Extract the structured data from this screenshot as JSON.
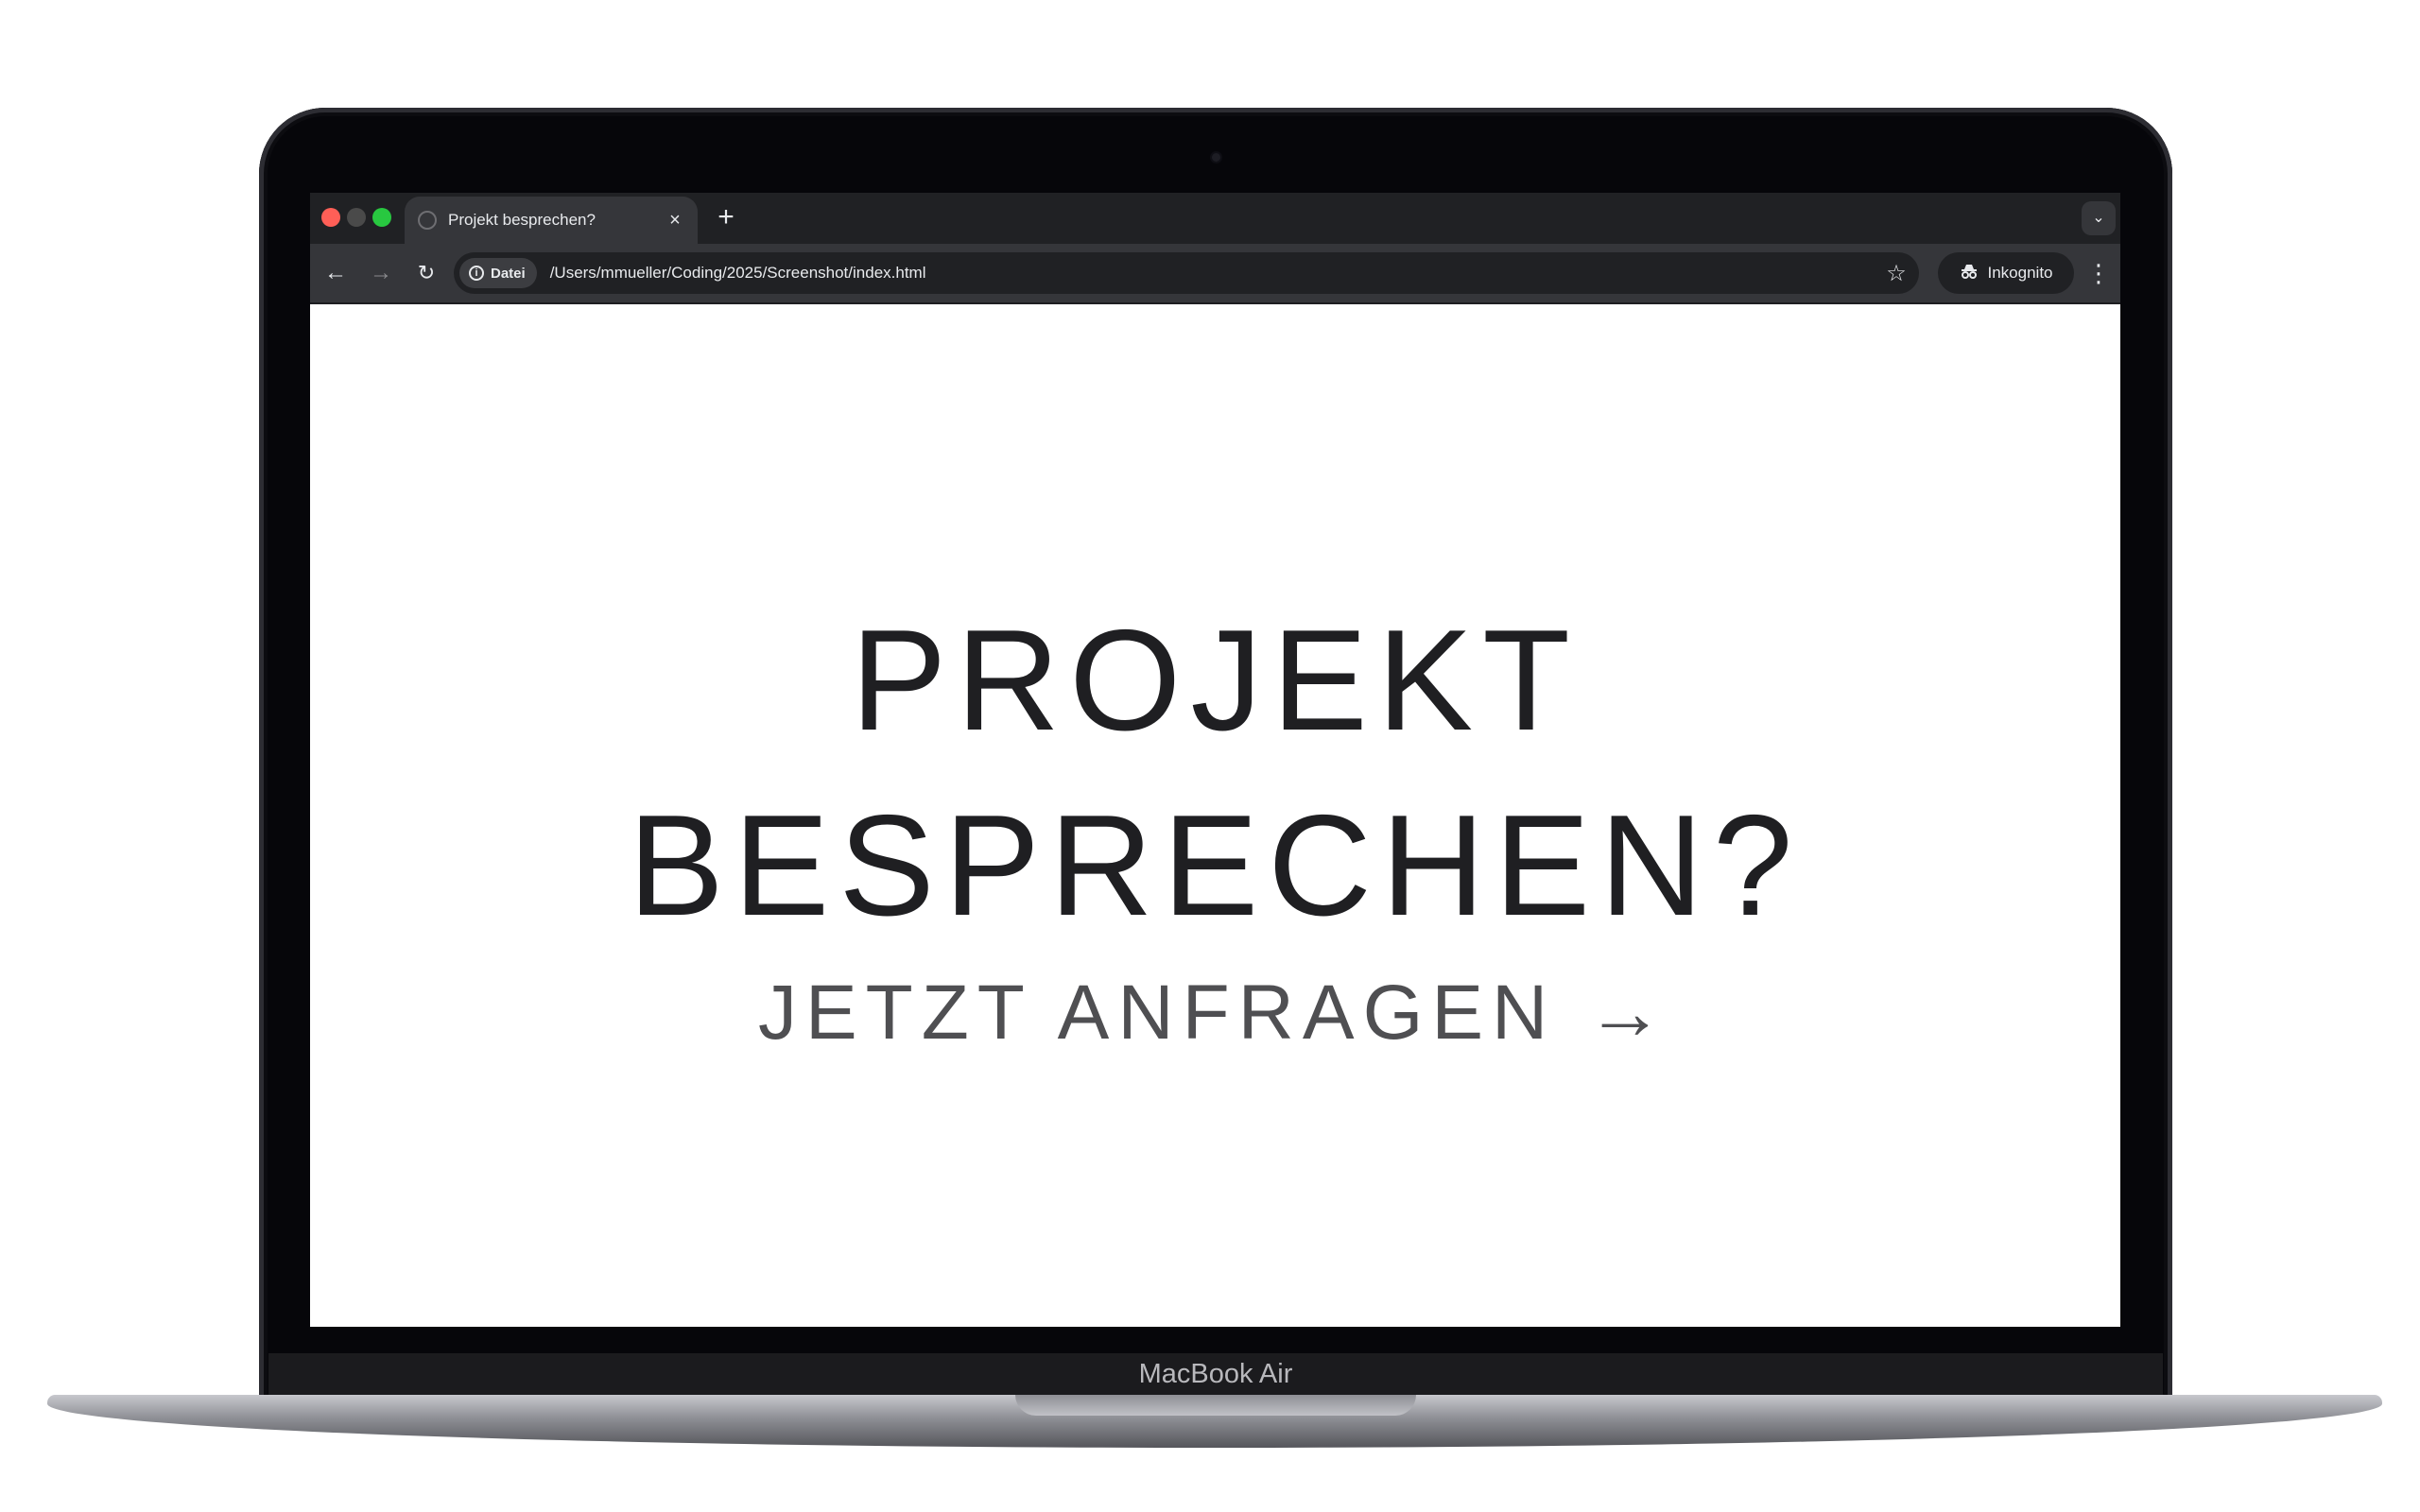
{
  "browser": {
    "tab_title": "Projekt besprechen?",
    "tab_close": "×",
    "new_tab": "+",
    "tab_menu": "⌄",
    "site_info_chip": "Datei",
    "url": "/Users/mmueller/Coding/2025/Screenshot/index.html",
    "incognito_label": "Inkognito",
    "icons": [
      "back-arrow-icon",
      "forward-arrow-icon",
      "reload-icon",
      "info-icon",
      "star-icon",
      "incognito-icon",
      "kebab-menu-icon"
    ]
  },
  "page": {
    "headline_line1": "PROJEKT",
    "headline_line2": "BESPRECHEN?",
    "cta_label": "JETZT ANFRAGEN →"
  },
  "device": {
    "label": "MacBook Air"
  },
  "colors": {
    "headline": "#1f1f22",
    "cta": "#4f4f52",
    "browser_frame": "#202124",
    "toolbar": "#35363a"
  }
}
